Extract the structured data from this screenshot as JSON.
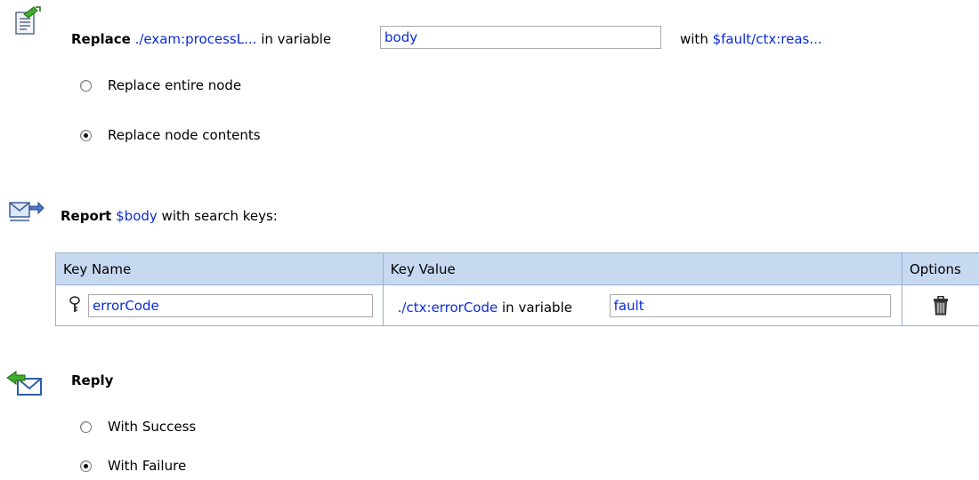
{
  "replace": {
    "keyword": "Replace",
    "path": "./exam:processL...",
    "in_variable": "in variable",
    "variable": "body",
    "with": "with",
    "expression": "$fault/ctx:reas...",
    "options": [
      {
        "label": "Replace entire node",
        "selected": false
      },
      {
        "label": "Replace node contents",
        "selected": true
      }
    ]
  },
  "report": {
    "keyword": "Report",
    "variable": "$body",
    "suffix": "with search keys:",
    "table": {
      "headers": [
        "Key Name",
        "Key Value",
        "Options"
      ],
      "rows": [
        {
          "key_name": "errorCode",
          "path": "./ctx:errorCode",
          "in_variable": "in variable",
          "variable": "fault"
        }
      ]
    }
  },
  "reply": {
    "keyword": "Reply",
    "options": [
      {
        "label": "With Success",
        "selected": false
      },
      {
        "label": "With Failure",
        "selected": true
      }
    ]
  },
  "colors": {
    "link": "#0a2bd8",
    "header_bg": "#c6d9f1",
    "border": "#9ab0cc"
  },
  "icons": [
    "replace-action-icon",
    "report-action-icon",
    "reply-action-icon",
    "key-icon",
    "trash-icon"
  ]
}
